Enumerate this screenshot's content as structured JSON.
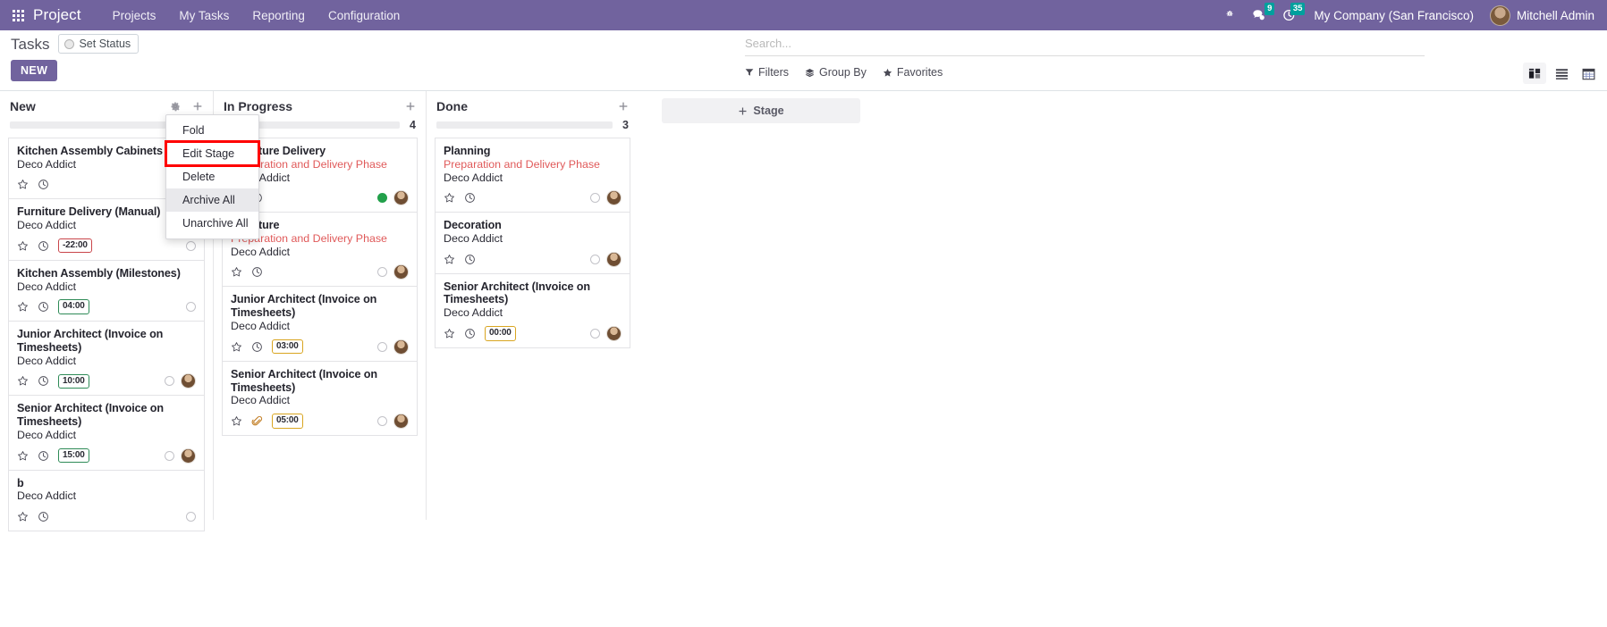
{
  "navbar": {
    "apps_icon": "apps-grid-icon",
    "brand": "Project",
    "menu": [
      {
        "label": "Projects"
      },
      {
        "label": "My Tasks"
      },
      {
        "label": "Reporting"
      },
      {
        "label": "Configuration"
      }
    ],
    "sys_icons": [
      {
        "name": "bug-icon",
        "badge": ""
      },
      {
        "name": "messages-icon",
        "badge": "9"
      },
      {
        "name": "activities-clock-icon",
        "badge": "35"
      }
    ],
    "company": "My Company (San Francisco)",
    "user": "Mitchell Admin",
    "accent_color": "#71639e",
    "badge_color": "#00a09d"
  },
  "control_panel": {
    "title": "Tasks",
    "set_status_label": "Set Status",
    "new_label": "NEW",
    "search_placeholder": "Search...",
    "search_value": "",
    "filters": [
      {
        "label": "Filters",
        "icon": "funnel-icon"
      },
      {
        "label": "Group By",
        "icon": "layers-icon"
      },
      {
        "label": "Favorites",
        "icon": "star-icon"
      }
    ],
    "views": [
      {
        "name": "kanban-view-icon",
        "active": true
      },
      {
        "name": "list-view-icon",
        "active": false
      },
      {
        "name": "calendar-view-icon",
        "active": false
      }
    ]
  },
  "stage_dropdown": {
    "items": [
      {
        "label": "Fold",
        "highlighted": false,
        "shaded": false
      },
      {
        "label": "Edit Stage",
        "highlighted": true,
        "shaded": false
      },
      {
        "label": "Delete",
        "highlighted": false,
        "shaded": false
      },
      {
        "label": "Archive All",
        "highlighted": false,
        "shaded": true
      },
      {
        "label": "Unarchive All",
        "highlighted": false,
        "shaded": false
      }
    ],
    "highlight_color": "#ff0000"
  },
  "kanban": {
    "add_stage_label": "Stage",
    "columns": [
      {
        "title": "New",
        "count": "",
        "progress_color": "#ececee",
        "progress_pct": 0,
        "cards": [
          {
            "title": "Kitchen Assembly Cabinets",
            "subtitle_danger": "",
            "customer": "Deco Addict",
            "time": "",
            "time_style": "",
            "state": "none",
            "avatar": false,
            "attachment": false
          },
          {
            "title": "Furniture Delivery (Manual)",
            "subtitle_danger": "",
            "customer": "Deco Addict",
            "time": "-22:00",
            "time_style": "danger",
            "state": "empty",
            "avatar": false,
            "attachment": false
          },
          {
            "title": "Kitchen Assembly (Milestones)",
            "subtitle_danger": "",
            "customer": "Deco Addict",
            "time": "04:00",
            "time_style": "success",
            "state": "empty",
            "avatar": false,
            "attachment": false
          },
          {
            "title": "Junior Architect (Invoice on Timesheets)",
            "subtitle_danger": "",
            "customer": "Deco Addict",
            "time": "10:00",
            "time_style": "success",
            "state": "empty",
            "avatar": true,
            "attachment": false
          },
          {
            "title": "Senior Architect (Invoice on Timesheets)",
            "subtitle_danger": "",
            "customer": "Deco Addict",
            "time": "15:00",
            "time_style": "success",
            "state": "empty",
            "avatar": true,
            "attachment": false
          },
          {
            "title": "b",
            "subtitle_danger": "",
            "customer": "Deco Addict",
            "time": "",
            "time_style": "",
            "state": "empty",
            "avatar": false,
            "attachment": false
          }
        ]
      },
      {
        "title": "In Progress",
        "count": "4",
        "progress_color": "#22a04b",
        "progress_pct": 7,
        "cards": [
          {
            "title": "Furniture Delivery",
            "subtitle_danger": "Preparation and Delivery Phase",
            "customer": "Deco Addict",
            "time": "",
            "time_style": "",
            "state": "green",
            "avatar": true,
            "attachment": false
          },
          {
            "title": "Furniture",
            "subtitle_danger": "Preparation and Delivery Phase",
            "customer": "Deco Addict",
            "time": "",
            "time_style": "",
            "state": "empty",
            "avatar": true,
            "attachment": false
          },
          {
            "title": "Junior Architect (Invoice on Timesheets)",
            "subtitle_danger": "",
            "customer": "Deco Addict",
            "time": "03:00",
            "time_style": "warning",
            "state": "empty",
            "avatar": true,
            "attachment": false
          },
          {
            "title": "Senior Architect (Invoice on Timesheets)",
            "subtitle_danger": "",
            "customer": "Deco Addict",
            "time": "05:00",
            "time_style": "warning",
            "state": "empty",
            "avatar": true,
            "attachment": true
          }
        ]
      },
      {
        "title": "Done",
        "count": "3",
        "progress_color": "#ececee",
        "progress_pct": 0,
        "cards": [
          {
            "title": "Planning",
            "subtitle_danger": "Preparation and Delivery Phase",
            "customer": "Deco Addict",
            "time": "",
            "time_style": "",
            "state": "empty",
            "avatar": true,
            "attachment": false
          },
          {
            "title": "Decoration",
            "subtitle_danger": "",
            "customer": "Deco Addict",
            "time": "",
            "time_style": "",
            "state": "empty",
            "avatar": true,
            "attachment": false
          },
          {
            "title": "Senior Architect (Invoice on Timesheets)",
            "subtitle_danger": "",
            "customer": "Deco Addict",
            "time": "00:00",
            "time_style": "warning",
            "state": "empty",
            "avatar": true,
            "attachment": false
          }
        ]
      }
    ]
  }
}
